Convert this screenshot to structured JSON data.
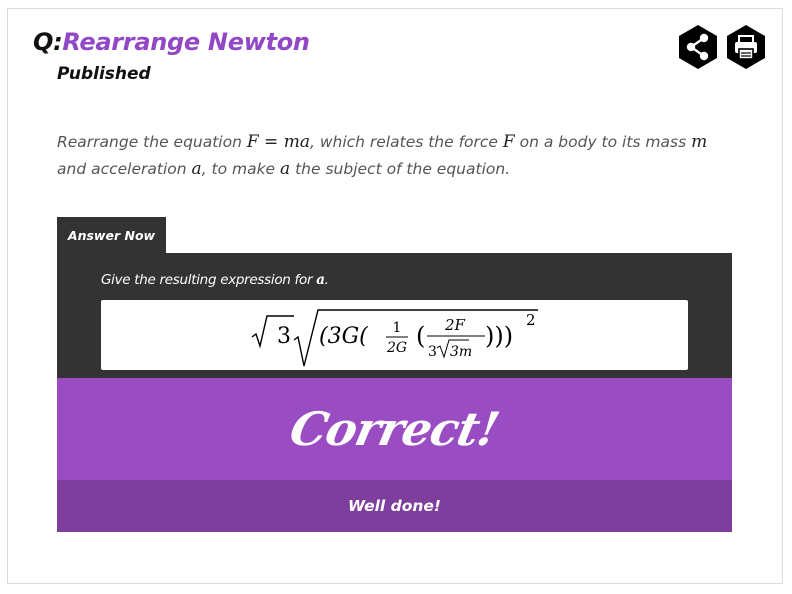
{
  "header": {
    "prefix": "Q:",
    "title": "Rearrange Newton",
    "status": "Published"
  },
  "toolbar": {
    "share_icon": "share-icon",
    "print_icon": "print-icon"
  },
  "question": {
    "t1": "Rearrange the equation ",
    "eq": "F = ma",
    "t2": ", which relates the force ",
    "f": "F",
    "t3": " on a body to its mass ",
    "m": "m",
    "t4": " and acceleration ",
    "a": "a",
    "t5": ", to make ",
    "a2": "a",
    "t6": " the subject of the equation."
  },
  "tab": {
    "label": "Answer Now"
  },
  "answer": {
    "prompt": "Give the resulting expression for ",
    "prompt_var": "a",
    "prompt_end": ".",
    "expression": {
      "outer_coef": "3",
      "open": "(3G(",
      "frac1_num": "1",
      "frac1_den": "2G",
      "frac2_num": "2F",
      "frac2_den_coef": "3",
      "frac2_den_rad": "3m",
      "close": ")))",
      "exponent": "2"
    }
  },
  "result": {
    "status": "Correct!",
    "message": "Well done!"
  },
  "colors": {
    "accent": "#9147c6",
    "panel_dark": "#333333",
    "correct_bg": "#9a4dc3",
    "feedback_bg": "#7d3e9e"
  }
}
